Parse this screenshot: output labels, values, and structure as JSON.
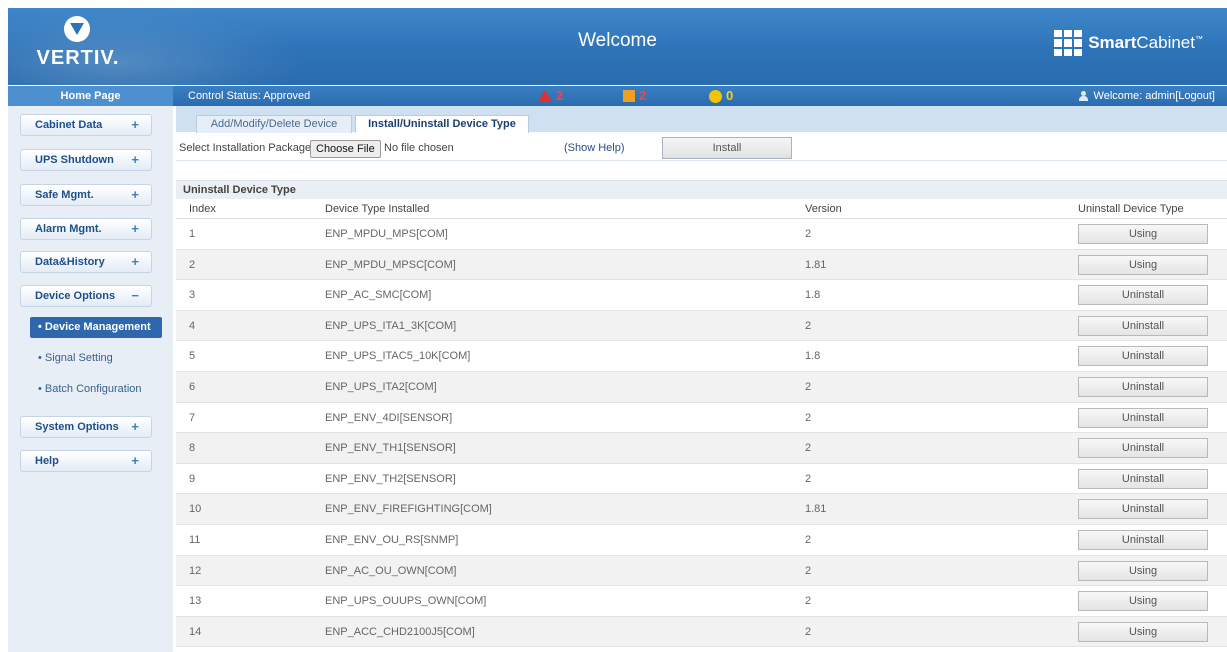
{
  "header": {
    "brand": "VERTIV.",
    "title": "Welcome",
    "product_bold": "Smart",
    "product_rest": "Cabinet",
    "tm": "™"
  },
  "statusbar": {
    "home": "Home Page",
    "control": "Control Status: Approved",
    "alarm_critical": "2",
    "alarm_major": "2",
    "alarm_minor": "0",
    "welcome": "Welcome: admin[Logout]",
    "colors": {
      "critical": "#e03030",
      "major": "#f0a020",
      "minor": "#f5c400"
    }
  },
  "sidebar": {
    "items": [
      {
        "label": "Cabinet Data",
        "sign": "+"
      },
      {
        "label": "UPS Shutdown",
        "sign": "+"
      },
      {
        "label": "Safe Mgmt.",
        "sign": "+"
      },
      {
        "label": "Alarm Mgmt.",
        "sign": "+"
      },
      {
        "label": "Data&History",
        "sign": "+"
      },
      {
        "label": "Device Options",
        "sign": "−"
      },
      {
        "label": "System Options",
        "sign": "+"
      },
      {
        "label": "Help",
        "sign": "+"
      }
    ],
    "subitems": [
      {
        "label": "• Device Management",
        "active": true
      },
      {
        "label": "• Signal Setting"
      },
      {
        "label": "• Batch Configuration"
      }
    ]
  },
  "tabs": [
    {
      "label": "Add/Modify/Delete Device"
    },
    {
      "label": "Install/Uninstall Device Type",
      "active": true
    }
  ],
  "toolbar": {
    "select_label": "Select Installation Package:",
    "choose_button": "Choose File",
    "file_status": "No file chosen",
    "help_link": "(Show Help)",
    "install_button": "Install"
  },
  "uninstall": {
    "section_title": "Uninstall Device Type",
    "columns": [
      "Index",
      "Device Type Installed",
      "Version",
      "Uninstall Device Type"
    ],
    "rows": [
      {
        "index": "1",
        "name": "ENP_MPDU_MPS[COM]",
        "version": "2",
        "action": "Using"
      },
      {
        "index": "2",
        "name": "ENP_MPDU_MPSC[COM]",
        "version": "1.81",
        "action": "Using"
      },
      {
        "index": "3",
        "name": "ENP_AC_SMC[COM]",
        "version": "1.8",
        "action": "Uninstall"
      },
      {
        "index": "4",
        "name": "ENP_UPS_ITA1_3K[COM]",
        "version": "2",
        "action": "Uninstall"
      },
      {
        "index": "5",
        "name": "ENP_UPS_ITAC5_10K[COM]",
        "version": "1.8",
        "action": "Uninstall"
      },
      {
        "index": "6",
        "name": "ENP_UPS_ITA2[COM]",
        "version": "2",
        "action": "Uninstall"
      },
      {
        "index": "7",
        "name": "ENP_ENV_4DI[SENSOR]",
        "version": "2",
        "action": "Uninstall"
      },
      {
        "index": "8",
        "name": "ENP_ENV_TH1[SENSOR]",
        "version": "2",
        "action": "Uninstall"
      },
      {
        "index": "9",
        "name": "ENP_ENV_TH2[SENSOR]",
        "version": "2",
        "action": "Uninstall"
      },
      {
        "index": "10",
        "name": "ENP_ENV_FIREFIGHTING[COM]",
        "version": "1.81",
        "action": "Uninstall"
      },
      {
        "index": "11",
        "name": "ENP_ENV_OU_RS[SNMP]",
        "version": "2",
        "action": "Uninstall"
      },
      {
        "index": "12",
        "name": "ENP_AC_OU_OWN[COM]",
        "version": "2",
        "action": "Using"
      },
      {
        "index": "13",
        "name": "ENP_UPS_OUUPS_OWN[COM]",
        "version": "2",
        "action": "Using"
      },
      {
        "index": "14",
        "name": "ENP_ACC_CHD2100J5[COM]",
        "version": "2",
        "action": "Using"
      }
    ]
  }
}
